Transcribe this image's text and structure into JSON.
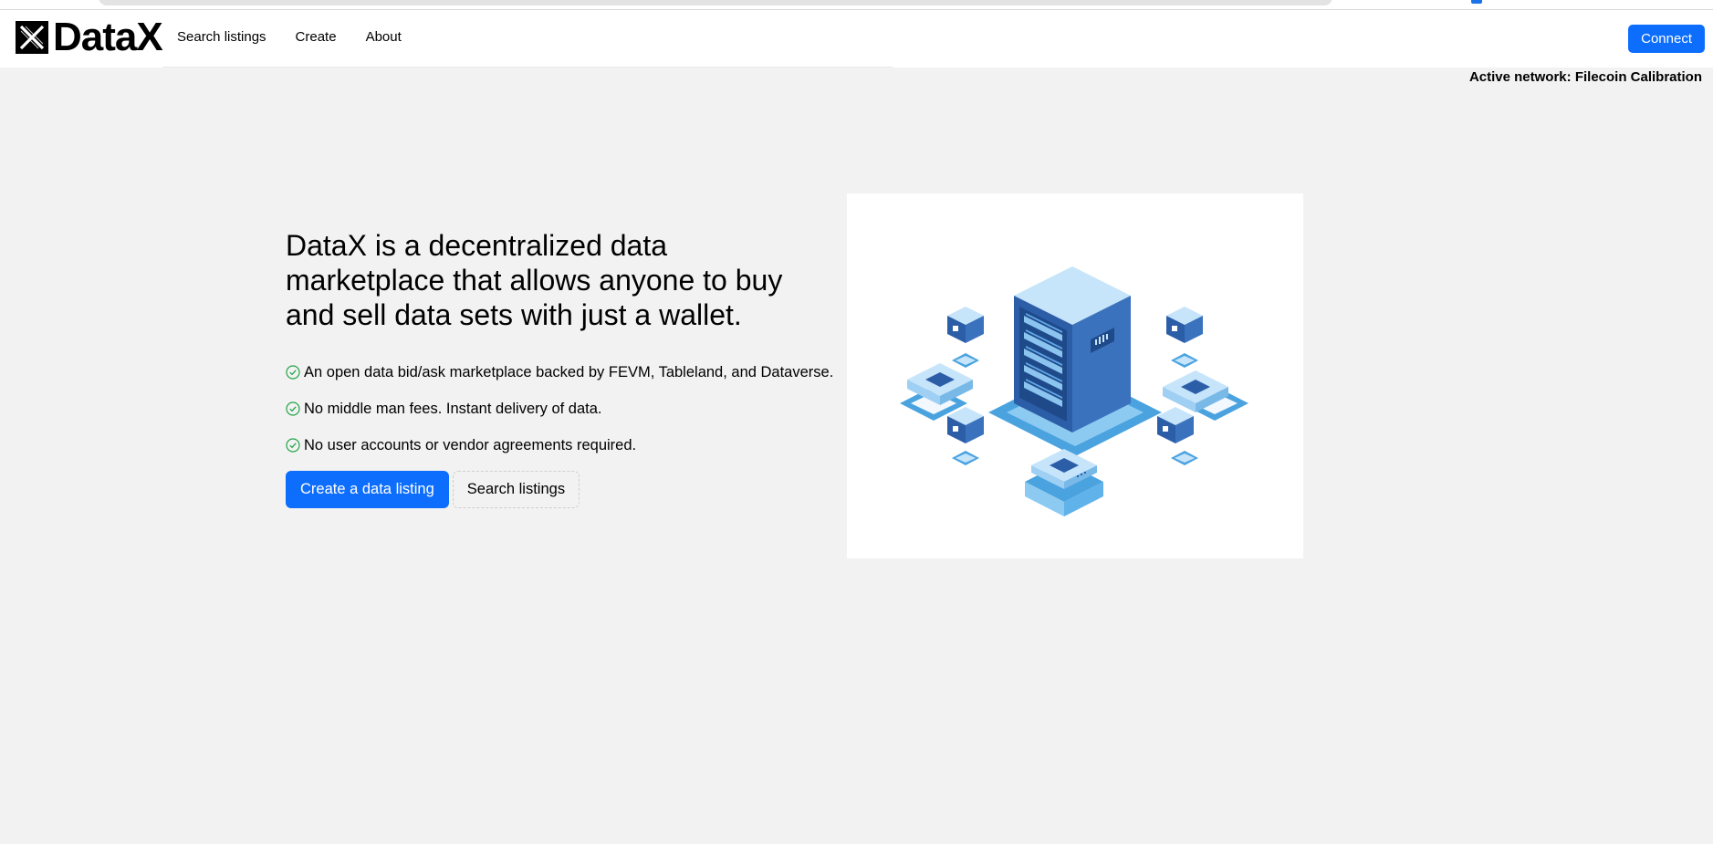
{
  "brand": {
    "name": "DataX",
    "logo_icon": "x-mark-logo-icon"
  },
  "nav": {
    "items": [
      {
        "label": "Search listings"
      },
      {
        "label": "Create"
      },
      {
        "label": "About"
      }
    ],
    "connect_label": "Connect"
  },
  "network": {
    "status": "Active network: Filecoin Calibration"
  },
  "hero": {
    "headline": "DataX is a decentralized data marketplace that allows anyone to buy and sell data sets with just a wallet.",
    "features": [
      {
        "icon": "check-circle-icon",
        "text": "An open data bid/ask marketplace backed by FEVM, Tableland, and Dataverse."
      },
      {
        "icon": "check-circle-icon",
        "text": "No middle man fees. Instant delivery of data."
      },
      {
        "icon": "check-circle-icon",
        "text": "No user accounts or vendor agreements required."
      }
    ],
    "primary_cta": "Create a data listing",
    "secondary_cta": "Search listings",
    "illustration": "server-datacenter-illustration"
  },
  "colors": {
    "primary": "#0d6efd",
    "background": "#f2f2f2",
    "check": "#22a447"
  }
}
